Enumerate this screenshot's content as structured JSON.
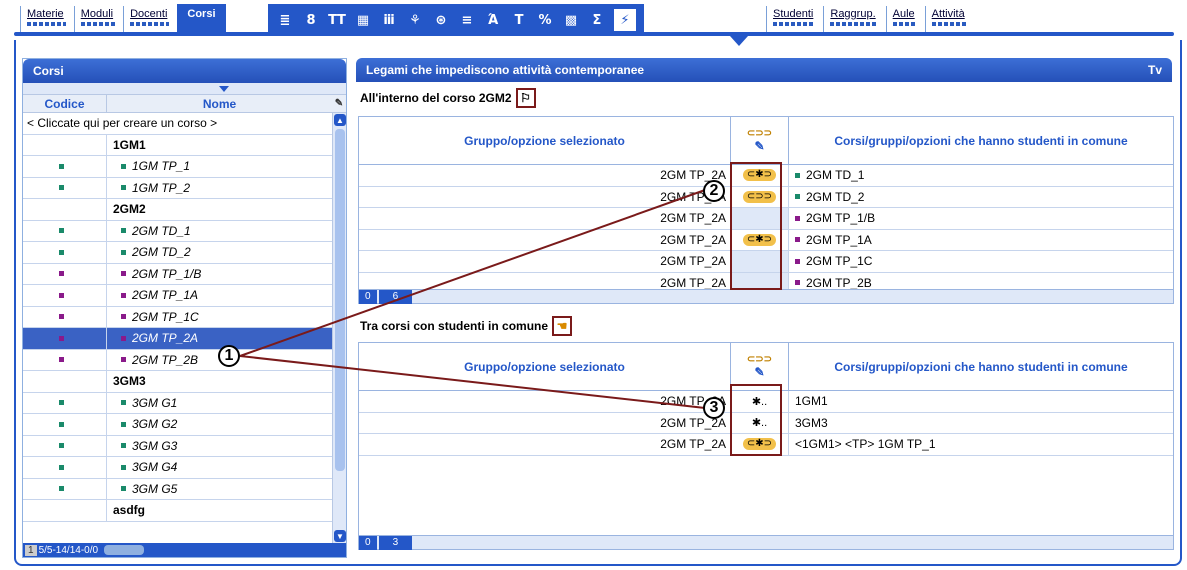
{
  "top_tabs_left": [
    "Materie",
    "Moduli",
    "Docenti"
  ],
  "active_tab": "Corsi",
  "toolbar_icons": [
    "≣",
    "8",
    "ΤΤ",
    "▦",
    "ⅲ",
    "⚘",
    "⊛",
    "≡",
    "Ά",
    "T",
    "%",
    "▩",
    "Σ",
    "⚡"
  ],
  "top_tabs_right": [
    "Studenti",
    "Raggrup.",
    "Aule",
    "Attività"
  ],
  "left_panel": {
    "title": "Corsi",
    "col_code": "Codice",
    "col_name": "Nome",
    "create_row": "< Cliccate qui per creare un corso >",
    "rows": [
      {
        "code": "",
        "name": "1GM1",
        "group": true,
        "color": ""
      },
      {
        "code": "■",
        "name": "1GM TP_1",
        "group": false,
        "color": "#1a8a6a"
      },
      {
        "code": "■",
        "name": "1GM TP_2",
        "group": false,
        "color": "#1a8a6a"
      },
      {
        "code": "",
        "name": "2GM2",
        "group": true,
        "color": ""
      },
      {
        "code": "■",
        "name": "2GM TD_1",
        "group": false,
        "color": "#1a8a6a"
      },
      {
        "code": "■",
        "name": "2GM TD_2",
        "group": false,
        "color": "#1a8a6a"
      },
      {
        "code": "■",
        "name": "2GM TP_1/B",
        "group": false,
        "color": "#8a1a8a"
      },
      {
        "code": "■",
        "name": "2GM TP_1A",
        "group": false,
        "color": "#8a1a8a"
      },
      {
        "code": "■",
        "name": "2GM TP_1C",
        "group": false,
        "color": "#8a1a8a"
      },
      {
        "code": "■",
        "name": "2GM TP_2A",
        "group": false,
        "color": "#8a1a8a",
        "selected": true
      },
      {
        "code": "■",
        "name": "2GM TP_2B",
        "group": false,
        "color": "#8a1a8a"
      },
      {
        "code": "",
        "name": "3GM3",
        "group": true,
        "color": ""
      },
      {
        "code": "■",
        "name": "3GM G1",
        "group": false,
        "color": "#1a8a6a"
      },
      {
        "code": "■",
        "name": "3GM G2",
        "group": false,
        "color": "#1a8a6a"
      },
      {
        "code": "■",
        "name": "3GM G3",
        "group": false,
        "color": "#1a8a6a"
      },
      {
        "code": "■",
        "name": "3GM G4",
        "group": false,
        "color": "#1a8a6a"
      },
      {
        "code": "■",
        "name": "3GM G5",
        "group": false,
        "color": "#1a8a6a"
      },
      {
        "code": "",
        "name": "asdfg",
        "group": true,
        "color": ""
      }
    ],
    "footer_num": "1",
    "footer_text": "5/5-14/14-0/0"
  },
  "right_panel": {
    "title": "Legami che impediscono attività contemporanee",
    "title_icon": "Tv",
    "section1": "All'interno del corso 2GM2",
    "section2": "Tra corsi con studenti in comune",
    "col_a": "Gruppo/opzione selezionato",
    "col_c": "Corsi/gruppi/opzioni che hanno studenti in comune",
    "col_b_top": "⊂⊃⊃",
    "col_b_bottom": "✎",
    "table1": [
      {
        "a": "2GM TP_2A",
        "b": "link",
        "c": "2GM TD_1",
        "color": "#1a8a6a"
      },
      {
        "a": "2GM TP_2A",
        "b": "link2",
        "c": "2GM TD_2",
        "color": "#1a8a6a"
      },
      {
        "a": "2GM TP_2A",
        "b": "",
        "c": "2GM TP_1/B",
        "color": "#8a1a8a"
      },
      {
        "a": "2GM TP_2A",
        "b": "link",
        "c": "2GM TP_1A",
        "color": "#8a1a8a"
      },
      {
        "a": "2GM TP_2A",
        "b": "",
        "c": "2GM TP_1C",
        "color": "#8a1a8a"
      },
      {
        "a": "2GM TP_2A",
        "b": "",
        "c": "2GM TP_2B",
        "color": "#8a1a8a"
      }
    ],
    "table1_footer": [
      "0",
      "6"
    ],
    "table2": [
      {
        "a": "2GM TP_2A",
        "b": "walk",
        "c": "1GM1"
      },
      {
        "a": "2GM TP_2A",
        "b": "walk",
        "c": "3GM3"
      },
      {
        "a": "2GM TP_2A",
        "b": "link",
        "c": "<1GM1> <TP> 1GM TP_1"
      }
    ],
    "table2_footer": [
      "0",
      "3"
    ]
  },
  "callouts": [
    "1",
    "2",
    "3"
  ]
}
